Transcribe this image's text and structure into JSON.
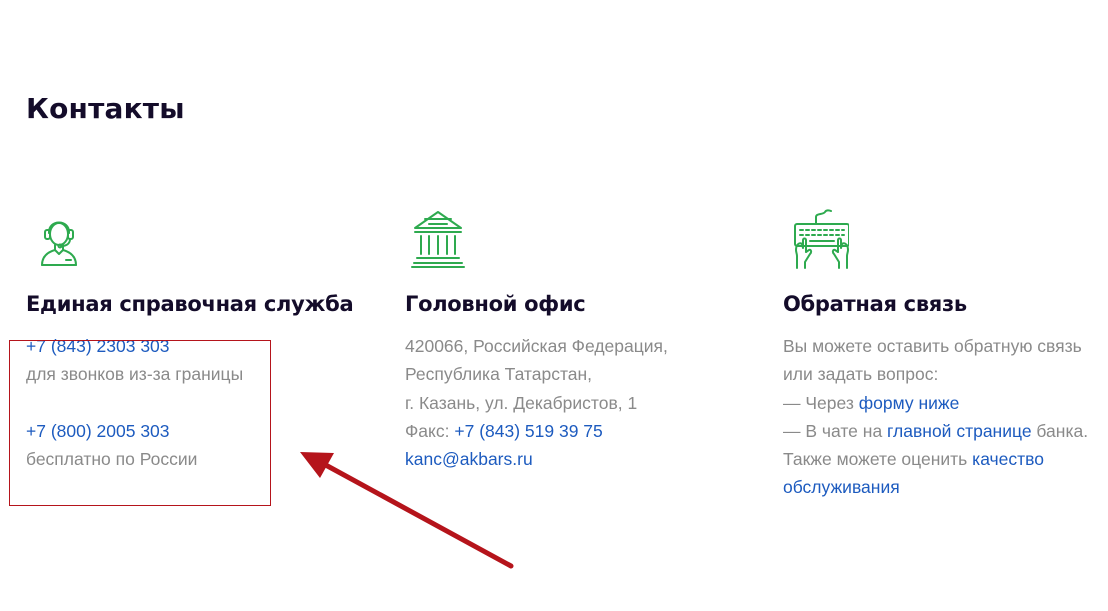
{
  "page": {
    "title": "Контакты"
  },
  "columns": [
    {
      "icon": "headset-operator-icon",
      "title": "Единая справочная служба",
      "phones": [
        {
          "number": "+7 (843) 2303 303",
          "note": "для звонков из-за границы"
        },
        {
          "number": "+7 (800) 2005 303",
          "note": "бесплатно по России"
        }
      ]
    },
    {
      "icon": "bank-building-icon",
      "title": "Головной офис",
      "address": [
        "420066, Российская Федерация,",
        "Республика Татарстан,",
        "г. Казань, ул. Декабристов, 1"
      ],
      "fax_label": "Факс: ",
      "fax": "+7 (843) 519 39 75",
      "email": "kanc@akbars.ru"
    },
    {
      "icon": "keyboard-hands-icon",
      "title": "Обратная связь",
      "intro": [
        "Вы можете оставить обратную связь",
        "или задать вопрос:"
      ],
      "via_form_prefix": "— Через ",
      "via_form_link": "форму ниже",
      "via_chat_prefix": "— В чате на ",
      "via_chat_link": "главной странице",
      "via_chat_suffix": " банка.",
      "rate_prefix": "Также можете оценить ",
      "rate_link_1": "качество",
      "rate_link_2": "обслуживания"
    }
  ],
  "colors": {
    "accent_green": "#2eaa4f",
    "link_blue": "#1d5bbf",
    "heading": "#140c2a",
    "muted_text": "#8a8a8a",
    "annotation_red": "#b5141b"
  }
}
